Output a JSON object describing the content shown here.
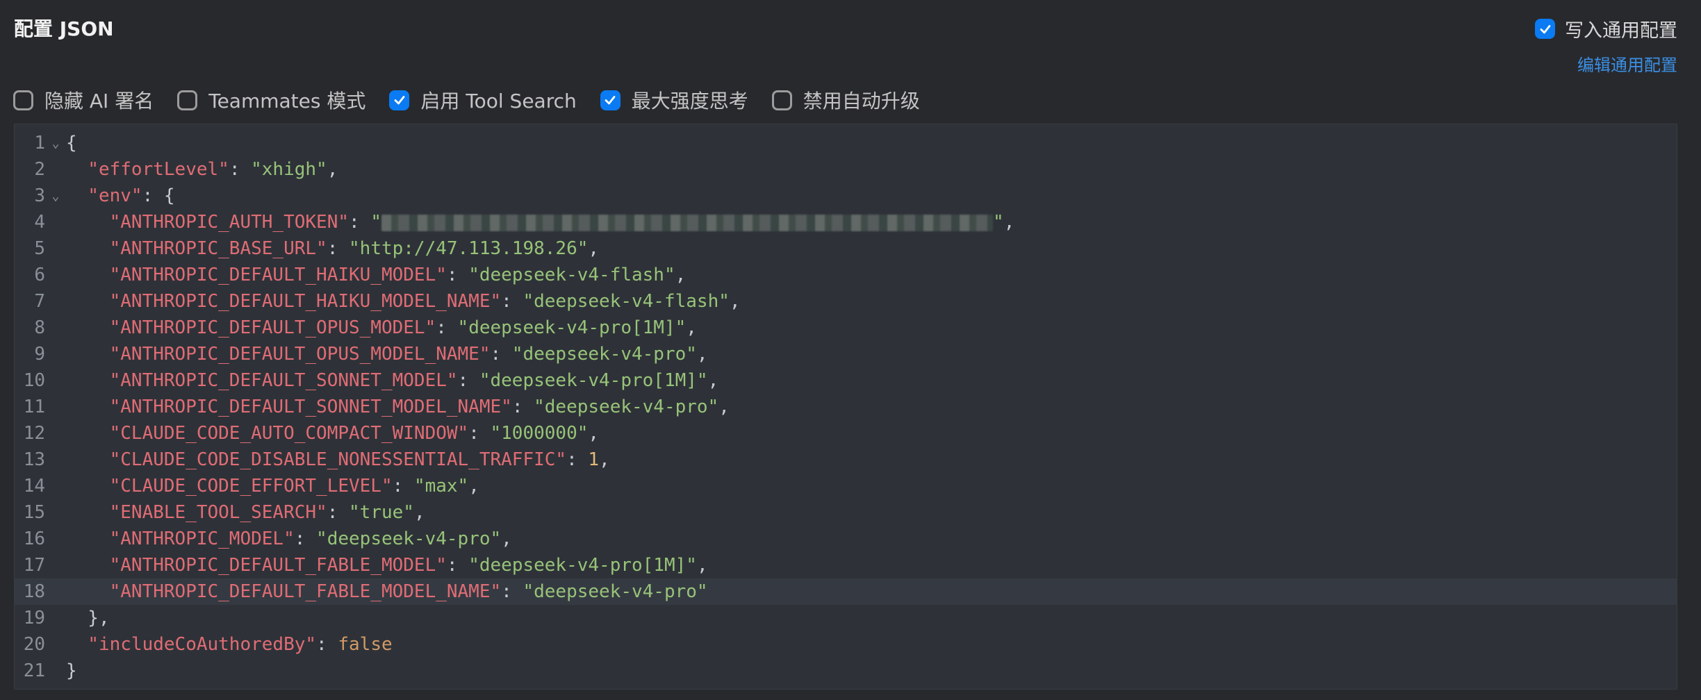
{
  "header": {
    "title": "配置 JSON",
    "write_global_label": "写入通用配置",
    "write_global_checked": true,
    "edit_global_link": "编辑通用配置"
  },
  "options": [
    {
      "label": "隐藏 AI 署名",
      "checked": false
    },
    {
      "label": "Teammates 模式",
      "checked": false
    },
    {
      "label": "启用 Tool Search",
      "checked": true
    },
    {
      "label": "最大强度思考",
      "checked": true
    },
    {
      "label": "禁用自动升级",
      "checked": false
    }
  ],
  "editor": {
    "active_line": 18,
    "lines": [
      {
        "n": "1",
        "fold": true,
        "parts": [
          {
            "t": "p",
            "v": "{"
          }
        ]
      },
      {
        "n": "2",
        "fold": false,
        "parts": [
          {
            "t": "p",
            "v": "  "
          },
          {
            "t": "k",
            "v": "\"effortLevel\""
          },
          {
            "t": "p",
            "v": ": "
          },
          {
            "t": "s",
            "v": "\"xhigh\""
          },
          {
            "t": "p",
            "v": ","
          }
        ]
      },
      {
        "n": "3",
        "fold": true,
        "parts": [
          {
            "t": "p",
            "v": "  "
          },
          {
            "t": "k",
            "v": "\"env\""
          },
          {
            "t": "p",
            "v": ": {"
          }
        ]
      },
      {
        "n": "4",
        "fold": false,
        "parts": [
          {
            "t": "p",
            "v": "    "
          },
          {
            "t": "k",
            "v": "\"ANTHROPIC_AUTH_TOKEN\""
          },
          {
            "t": "p",
            "v": ": "
          },
          {
            "t": "s",
            "v": "\""
          },
          {
            "t": "r",
            "v": ""
          },
          {
            "t": "s",
            "v": "\""
          },
          {
            "t": "p",
            "v": ","
          }
        ]
      },
      {
        "n": "5",
        "fold": false,
        "parts": [
          {
            "t": "p",
            "v": "    "
          },
          {
            "t": "k",
            "v": "\"ANTHROPIC_BASE_URL\""
          },
          {
            "t": "p",
            "v": ": "
          },
          {
            "t": "s",
            "v": "\"http://47.113.198.26\""
          },
          {
            "t": "p",
            "v": ","
          }
        ]
      },
      {
        "n": "6",
        "fold": false,
        "parts": [
          {
            "t": "p",
            "v": "    "
          },
          {
            "t": "k",
            "v": "\"ANTHROPIC_DEFAULT_HAIKU_MODEL\""
          },
          {
            "t": "p",
            "v": ": "
          },
          {
            "t": "s",
            "v": "\"deepseek-v4-flash\""
          },
          {
            "t": "p",
            "v": ","
          }
        ]
      },
      {
        "n": "7",
        "fold": false,
        "parts": [
          {
            "t": "p",
            "v": "    "
          },
          {
            "t": "k",
            "v": "\"ANTHROPIC_DEFAULT_HAIKU_MODEL_NAME\""
          },
          {
            "t": "p",
            "v": ": "
          },
          {
            "t": "s",
            "v": "\"deepseek-v4-flash\""
          },
          {
            "t": "p",
            "v": ","
          }
        ]
      },
      {
        "n": "8",
        "fold": false,
        "parts": [
          {
            "t": "p",
            "v": "    "
          },
          {
            "t": "k",
            "v": "\"ANTHROPIC_DEFAULT_OPUS_MODEL\""
          },
          {
            "t": "p",
            "v": ": "
          },
          {
            "t": "s",
            "v": "\"deepseek-v4-pro[1M]\""
          },
          {
            "t": "p",
            "v": ","
          }
        ]
      },
      {
        "n": "9",
        "fold": false,
        "parts": [
          {
            "t": "p",
            "v": "    "
          },
          {
            "t": "k",
            "v": "\"ANTHROPIC_DEFAULT_OPUS_MODEL_NAME\""
          },
          {
            "t": "p",
            "v": ": "
          },
          {
            "t": "s",
            "v": "\"deepseek-v4-pro\""
          },
          {
            "t": "p",
            "v": ","
          }
        ]
      },
      {
        "n": "10",
        "fold": false,
        "parts": [
          {
            "t": "p",
            "v": "    "
          },
          {
            "t": "k",
            "v": "\"ANTHROPIC_DEFAULT_SONNET_MODEL\""
          },
          {
            "t": "p",
            "v": ": "
          },
          {
            "t": "s",
            "v": "\"deepseek-v4-pro[1M]\""
          },
          {
            "t": "p",
            "v": ","
          }
        ]
      },
      {
        "n": "11",
        "fold": false,
        "parts": [
          {
            "t": "p",
            "v": "    "
          },
          {
            "t": "k",
            "v": "\"ANTHROPIC_DEFAULT_SONNET_MODEL_NAME\""
          },
          {
            "t": "p",
            "v": ": "
          },
          {
            "t": "s",
            "v": "\"deepseek-v4-pro\""
          },
          {
            "t": "p",
            "v": ","
          }
        ]
      },
      {
        "n": "12",
        "fold": false,
        "parts": [
          {
            "t": "p",
            "v": "    "
          },
          {
            "t": "k",
            "v": "\"CLAUDE_CODE_AUTO_COMPACT_WINDOW\""
          },
          {
            "t": "p",
            "v": ": "
          },
          {
            "t": "s",
            "v": "\"1000000\""
          },
          {
            "t": "p",
            "v": ","
          }
        ]
      },
      {
        "n": "13",
        "fold": false,
        "parts": [
          {
            "t": "p",
            "v": "    "
          },
          {
            "t": "k",
            "v": "\"CLAUDE_CODE_DISABLE_NONESSENTIAL_TRAFFIC\""
          },
          {
            "t": "p",
            "v": ": "
          },
          {
            "t": "n",
            "v": "1"
          },
          {
            "t": "p",
            "v": ","
          }
        ]
      },
      {
        "n": "14",
        "fold": false,
        "parts": [
          {
            "t": "p",
            "v": "    "
          },
          {
            "t": "k",
            "v": "\"CLAUDE_CODE_EFFORT_LEVEL\""
          },
          {
            "t": "p",
            "v": ": "
          },
          {
            "t": "s",
            "v": "\"max\""
          },
          {
            "t": "p",
            "v": ","
          }
        ]
      },
      {
        "n": "15",
        "fold": false,
        "parts": [
          {
            "t": "p",
            "v": "    "
          },
          {
            "t": "k",
            "v": "\"ENABLE_TOOL_SEARCH\""
          },
          {
            "t": "p",
            "v": ": "
          },
          {
            "t": "s",
            "v": "\"true\""
          },
          {
            "t": "p",
            "v": ","
          }
        ]
      },
      {
        "n": "16",
        "fold": false,
        "parts": [
          {
            "t": "p",
            "v": "    "
          },
          {
            "t": "k",
            "v": "\"ANTHROPIC_MODEL\""
          },
          {
            "t": "p",
            "v": ": "
          },
          {
            "t": "s",
            "v": "\"deepseek-v4-pro\""
          },
          {
            "t": "p",
            "v": ","
          }
        ]
      },
      {
        "n": "17",
        "fold": false,
        "parts": [
          {
            "t": "p",
            "v": "    "
          },
          {
            "t": "k",
            "v": "\"ANTHROPIC_DEFAULT_FABLE_MODEL\""
          },
          {
            "t": "p",
            "v": ": "
          },
          {
            "t": "s",
            "v": "\"deepseek-v4-pro[1M]\""
          },
          {
            "t": "p",
            "v": ","
          }
        ]
      },
      {
        "n": "18",
        "fold": false,
        "parts": [
          {
            "t": "p",
            "v": "    "
          },
          {
            "t": "k",
            "v": "\"ANTHROPIC_DEFAULT_FABLE_MODEL_NAME\""
          },
          {
            "t": "p",
            "v": ": "
          },
          {
            "t": "s",
            "v": "\"deepseek-v4-pro\""
          }
        ]
      },
      {
        "n": "19",
        "fold": false,
        "parts": [
          {
            "t": "p",
            "v": "  },"
          }
        ]
      },
      {
        "n": "20",
        "fold": false,
        "parts": [
          {
            "t": "p",
            "v": "  "
          },
          {
            "t": "k",
            "v": "\"includeCoAuthoredBy\""
          },
          {
            "t": "p",
            "v": ": "
          },
          {
            "t": "b",
            "v": "false"
          }
        ]
      },
      {
        "n": "21",
        "fold": false,
        "parts": [
          {
            "t": "p",
            "v": "}"
          }
        ]
      }
    ]
  }
}
